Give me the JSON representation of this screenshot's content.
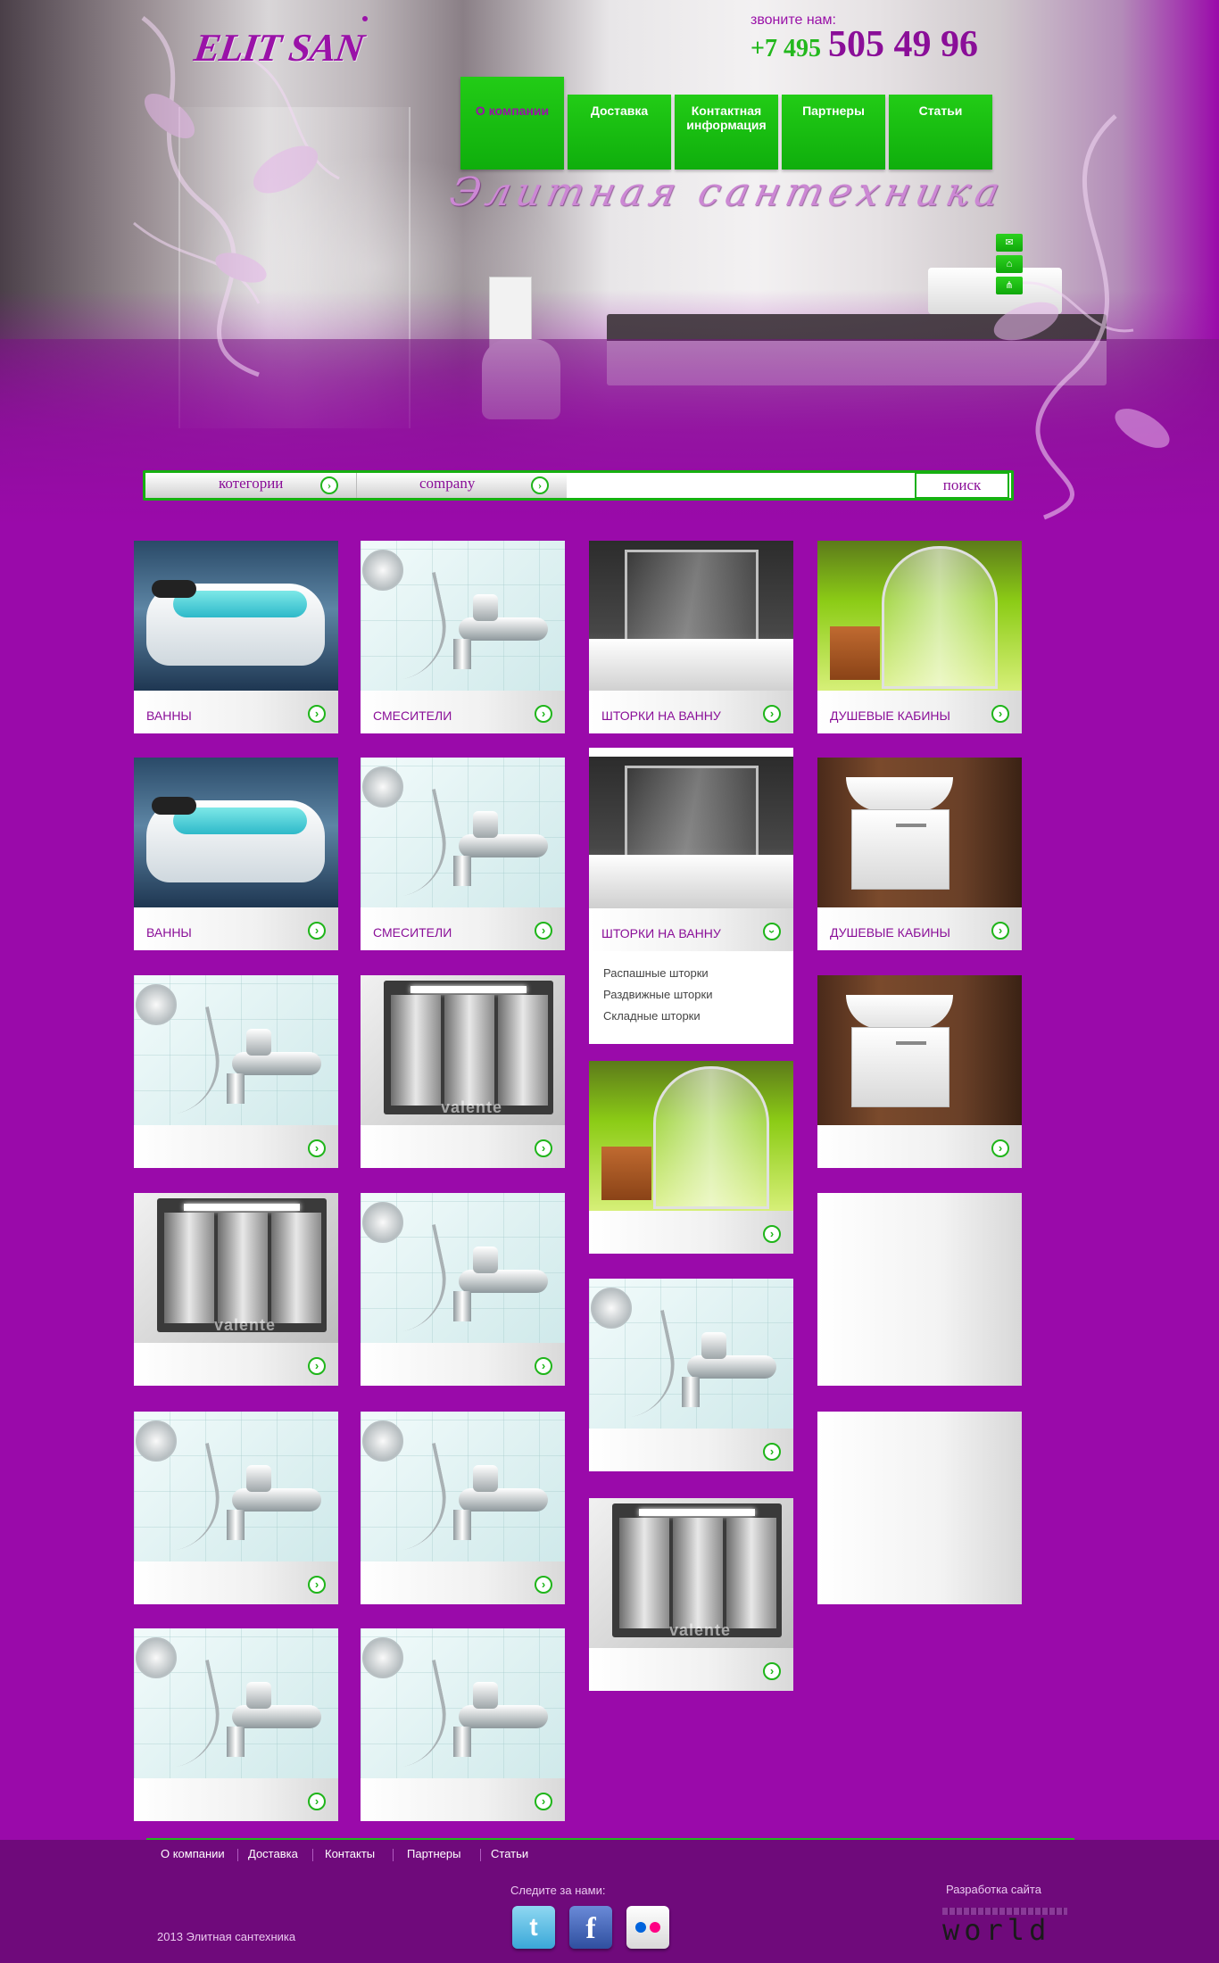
{
  "brand": {
    "logo": "ELIT SAN"
  },
  "contact": {
    "label": "звоните нам:",
    "code": "+7 495",
    "number": "505 49 96"
  },
  "nav": [
    {
      "label": "О компании",
      "active": true
    },
    {
      "label": "Доставка"
    },
    {
      "label": "Контактная информация"
    },
    {
      "label": "Партнеры"
    },
    {
      "label": "Статьи"
    }
  ],
  "slogan": "Элитная сантехника",
  "side_icons": [
    "mail-icon",
    "home-icon",
    "sitemap-icon"
  ],
  "search": {
    "category_label": "котегории",
    "company_label": "company",
    "input_value": "",
    "button_label": "поиск"
  },
  "products": {
    "c1": [
      {
        "label": "ВАННЫ"
      },
      {
        "label": "ВАННЫ"
      },
      {
        "label": ""
      },
      {
        "label": ""
      },
      {
        "label": ""
      },
      {
        "label": ""
      }
    ],
    "c2": [
      {
        "label": "СМЕСИТЕЛИ"
      },
      {
        "label": "СМЕСИТЕЛИ"
      },
      {
        "label": ""
      },
      {
        "label": ""
      },
      {
        "label": ""
      },
      {
        "label": ""
      }
    ],
    "c3": [
      {
        "label": "ШТОРКИ НА ВАННУ"
      },
      {
        "label": "ШТОРКИ НА ВАННУ",
        "submenu": [
          "Распашные шторки",
          "Раздвижные шторки",
          "Складные шторки"
        ]
      },
      {
        "label": ""
      },
      {
        "label": ""
      },
      {
        "label": ""
      }
    ],
    "c4": [
      {
        "label": "ДУШЕВЫЕ КАБИНЫ"
      },
      {
        "label": "ДУШЕВЫЕ КАБИНЫ"
      },
      {
        "label": ""
      }
    ]
  },
  "watermark": "valente",
  "footer": {
    "links": [
      "О компании",
      "Доставка",
      "Контакты",
      "Партнеры",
      "Статьи"
    ],
    "follow_label": "Следите за нами:",
    "copyright": "2013 Элитная сантехника",
    "dev_label": "Разработка сайта",
    "dev_logo": "world"
  },
  "colors": {
    "brand_purple": "#9a0aaa",
    "accent_green": "#16b011",
    "footer_purple": "#6f0a7b"
  }
}
